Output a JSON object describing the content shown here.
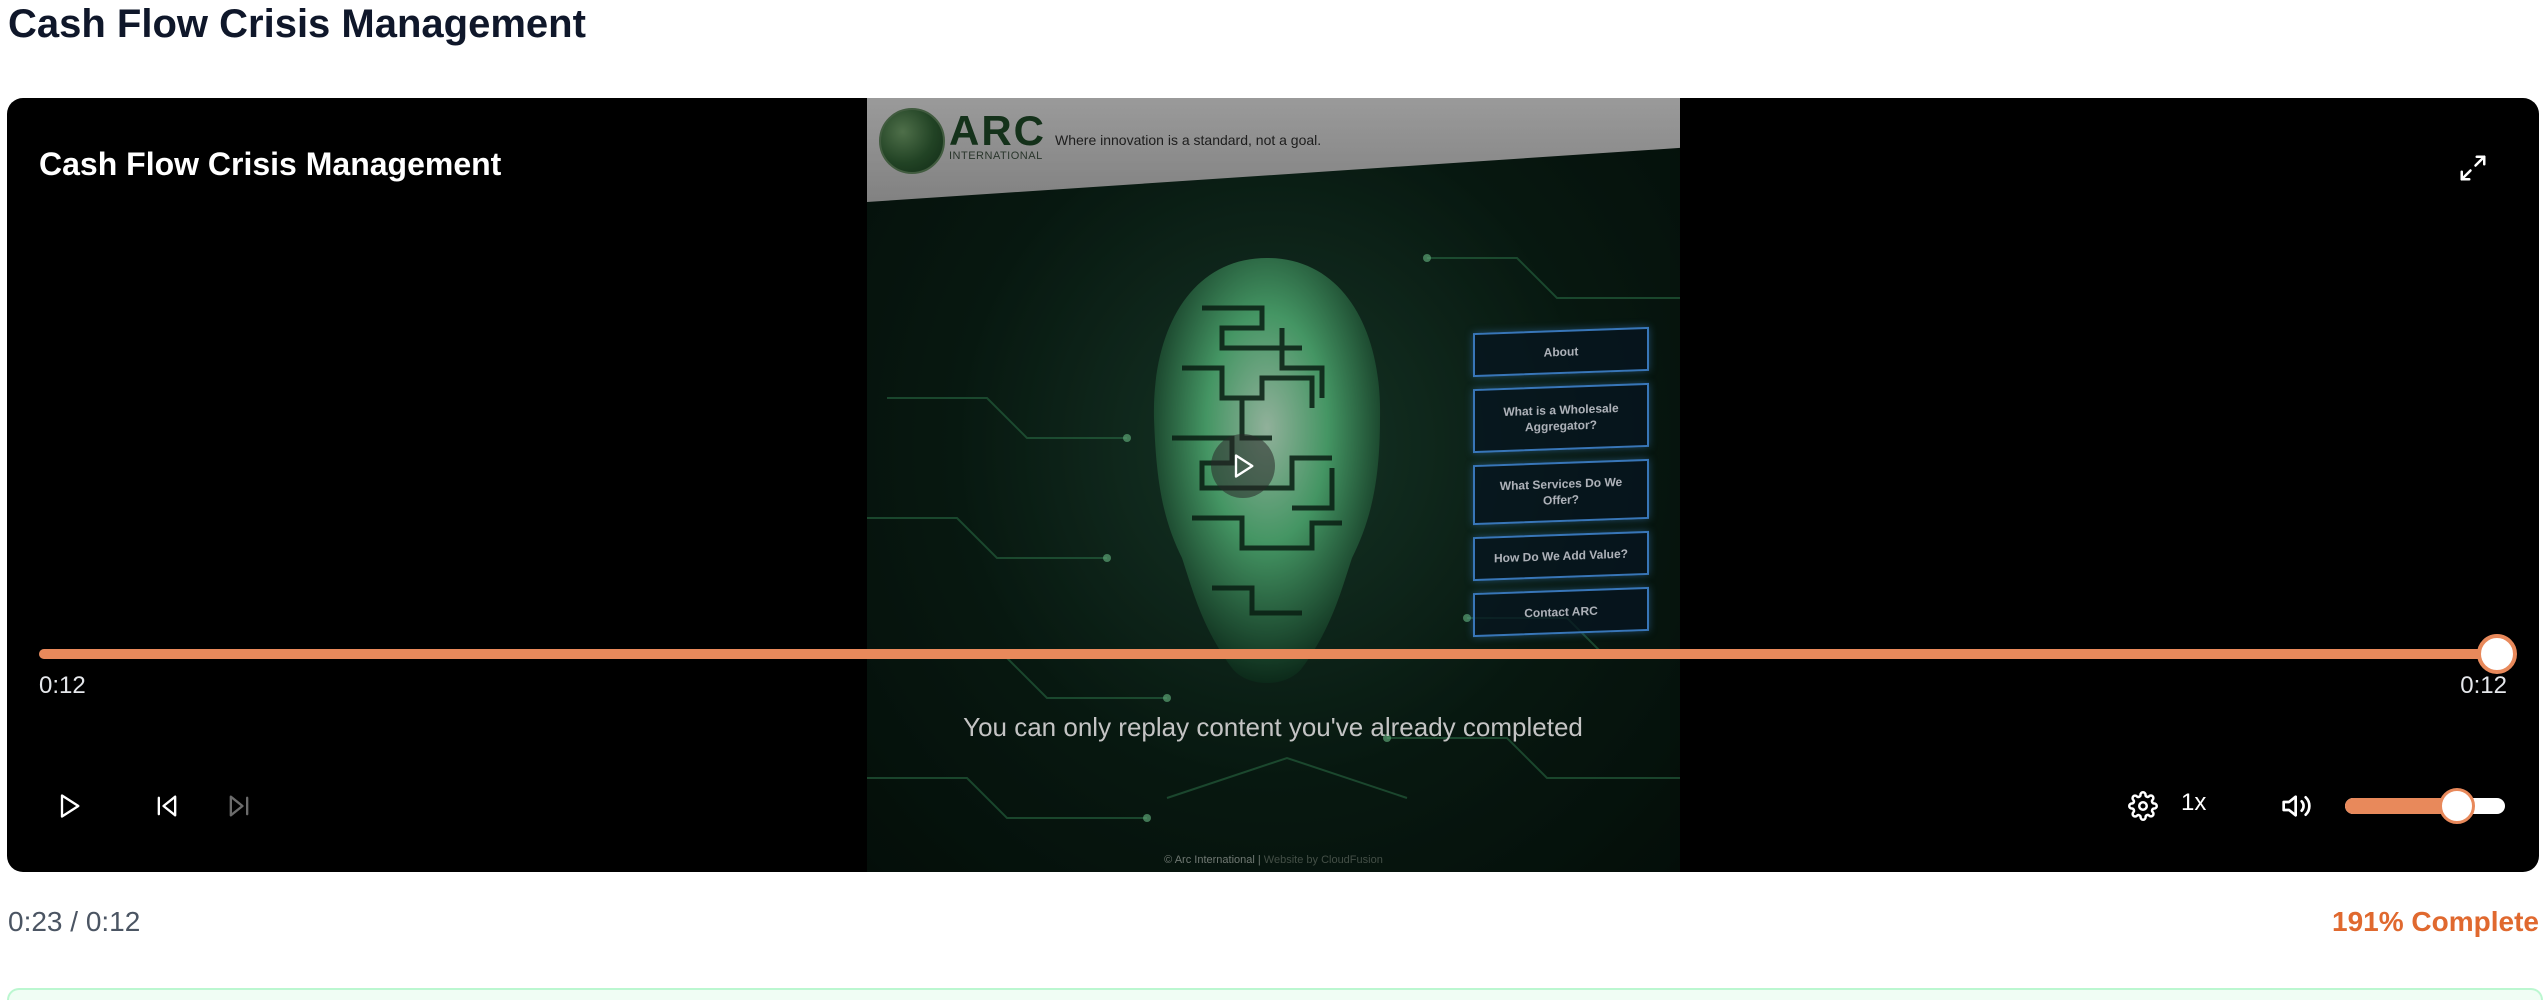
{
  "page": {
    "title": "Cash Flow Crisis Management"
  },
  "player": {
    "title": "Cash Flow Crisis Management",
    "current_time": "0:12",
    "duration": "0:12",
    "progress_fraction": 1.0,
    "replay_message": "You can only replay content you've already completed",
    "speed": "1x",
    "volume_fraction": 0.7,
    "accent_color": "#e8895b",
    "icons": {
      "fullscreen": "expand-arrows-icon",
      "center_play": "play-icon",
      "play": "play-icon",
      "previous": "skip-back-icon",
      "next": "skip-forward-icon",
      "settings": "gear-icon",
      "volume": "volume-icon"
    }
  },
  "video_frame": {
    "logo": "ARC",
    "logo_sub": "INTERNATIONAL",
    "tagline": "Where innovation is a standard, not a goal.",
    "menu": [
      "About",
      "What is a Wholesale Aggregator?",
      "What Services Do We Offer?",
      "How Do We Add Value?",
      "Contact ARC"
    ],
    "footer_left": "© Arc International |",
    "footer_right": "Website by CloudFusion"
  },
  "summary": {
    "time": "0:23 / 0:12",
    "complete": "191% Complete",
    "complete_color": "#e0692f"
  }
}
